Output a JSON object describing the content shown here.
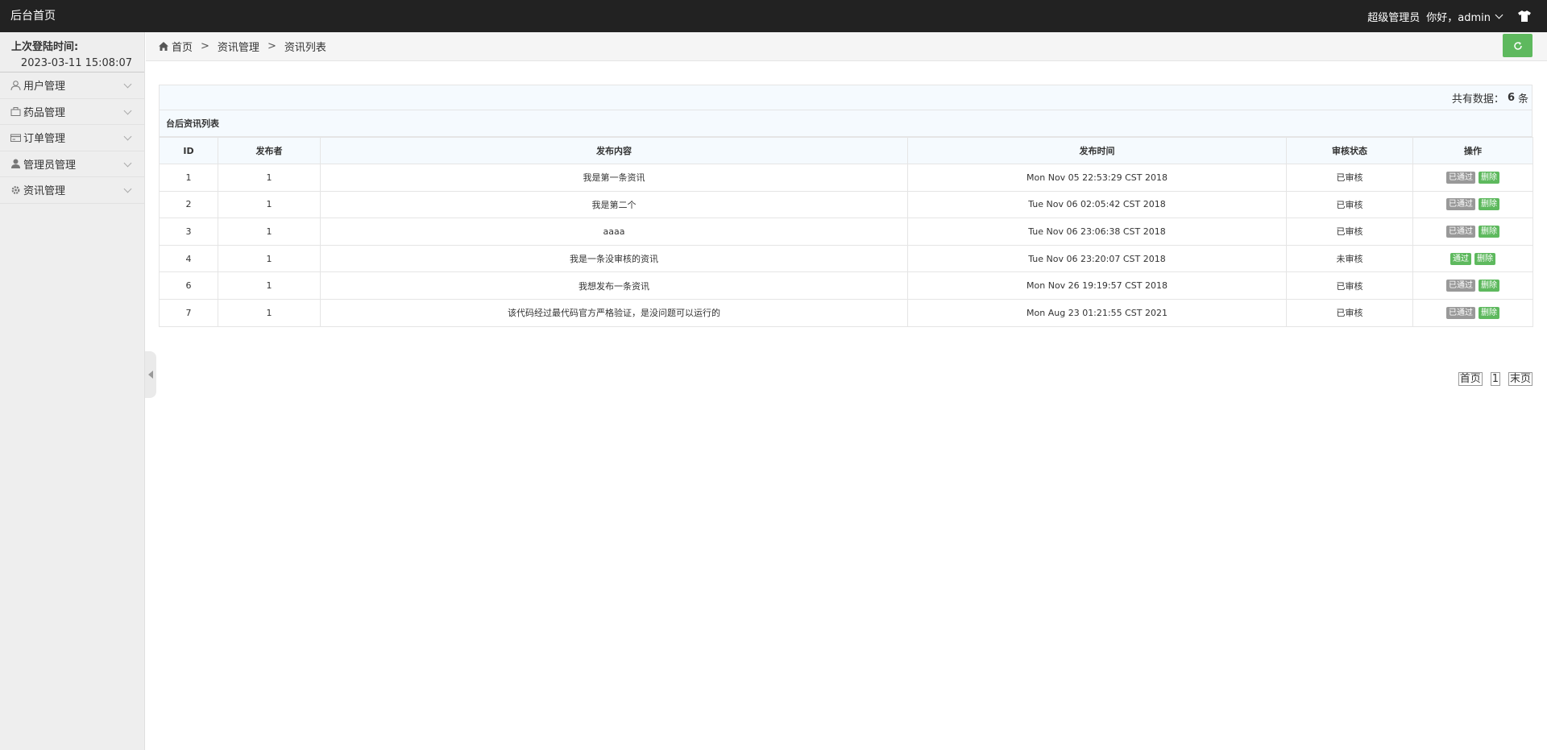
{
  "header": {
    "title": "后台首页",
    "role": "超级管理员",
    "greeting": "你好，admin"
  },
  "sidebar": {
    "last_login_label": "上次登陆时间:",
    "last_login_time": "2023-03-11 15:08:07",
    "items": [
      {
        "label": "用户管理",
        "icon": "user-outline-icon"
      },
      {
        "label": "药品管理",
        "icon": "bag-icon"
      },
      {
        "label": "订单管理",
        "icon": "card-icon"
      },
      {
        "label": "管理员管理",
        "icon": "user-solid-icon"
      },
      {
        "label": "资讯管理",
        "icon": "gear-icon"
      }
    ]
  },
  "breadcrumb": {
    "home": "首页",
    "section": "资讯管理",
    "page": "资讯列表",
    "separator": ">"
  },
  "summary": {
    "prefix": "共有数据：",
    "count": "6",
    "suffix": "条"
  },
  "table": {
    "title": "台后资讯列表",
    "headers": [
      "ID",
      "发布者",
      "发布内容",
      "发布时间",
      "审核状态",
      "操作"
    ],
    "rows": [
      {
        "id": "1",
        "publisher": "1",
        "content": "我是第一条资讯",
        "time": "Mon Nov 05 22:53:29 CST 2018",
        "status": "已审核",
        "action": "已通过",
        "action_style": "gray",
        "delete": "删除"
      },
      {
        "id": "2",
        "publisher": "1",
        "content": "我是第二个",
        "time": "Tue Nov 06 02:05:42 CST 2018",
        "status": "已审核",
        "action": "已通过",
        "action_style": "gray",
        "delete": "删除"
      },
      {
        "id": "3",
        "publisher": "1",
        "content": "aaaa",
        "time": "Tue Nov 06 23:06:38 CST 2018",
        "status": "已审核",
        "action": "已通过",
        "action_style": "gray",
        "delete": "删除"
      },
      {
        "id": "4",
        "publisher": "1",
        "content": "我是一条没审核的资讯",
        "time": "Tue Nov 06 23:20:07 CST 2018",
        "status": "未审核",
        "action": "通过",
        "action_style": "green",
        "delete": "删除"
      },
      {
        "id": "6",
        "publisher": "1",
        "content": "我想发布一条资讯",
        "time": "Mon Nov 26 19:19:57 CST 2018",
        "status": "已审核",
        "action": "已通过",
        "action_style": "gray",
        "delete": "删除"
      },
      {
        "id": "7",
        "publisher": "1",
        "content": "该代码经过最代码官方严格验证，是没问题可以运行的",
        "time": "Mon Aug 23 01:21:55 CST 2021",
        "status": "已审核",
        "action": "已通过",
        "action_style": "gray",
        "delete": "删除"
      }
    ]
  },
  "pager": {
    "first": "首页",
    "current": "1",
    "last": "末页"
  },
  "colors": {
    "header_bg": "#222222",
    "sidebar_bg": "#eeeeee",
    "accent_green": "#5eb95e",
    "disabled_gray": "#999999"
  }
}
